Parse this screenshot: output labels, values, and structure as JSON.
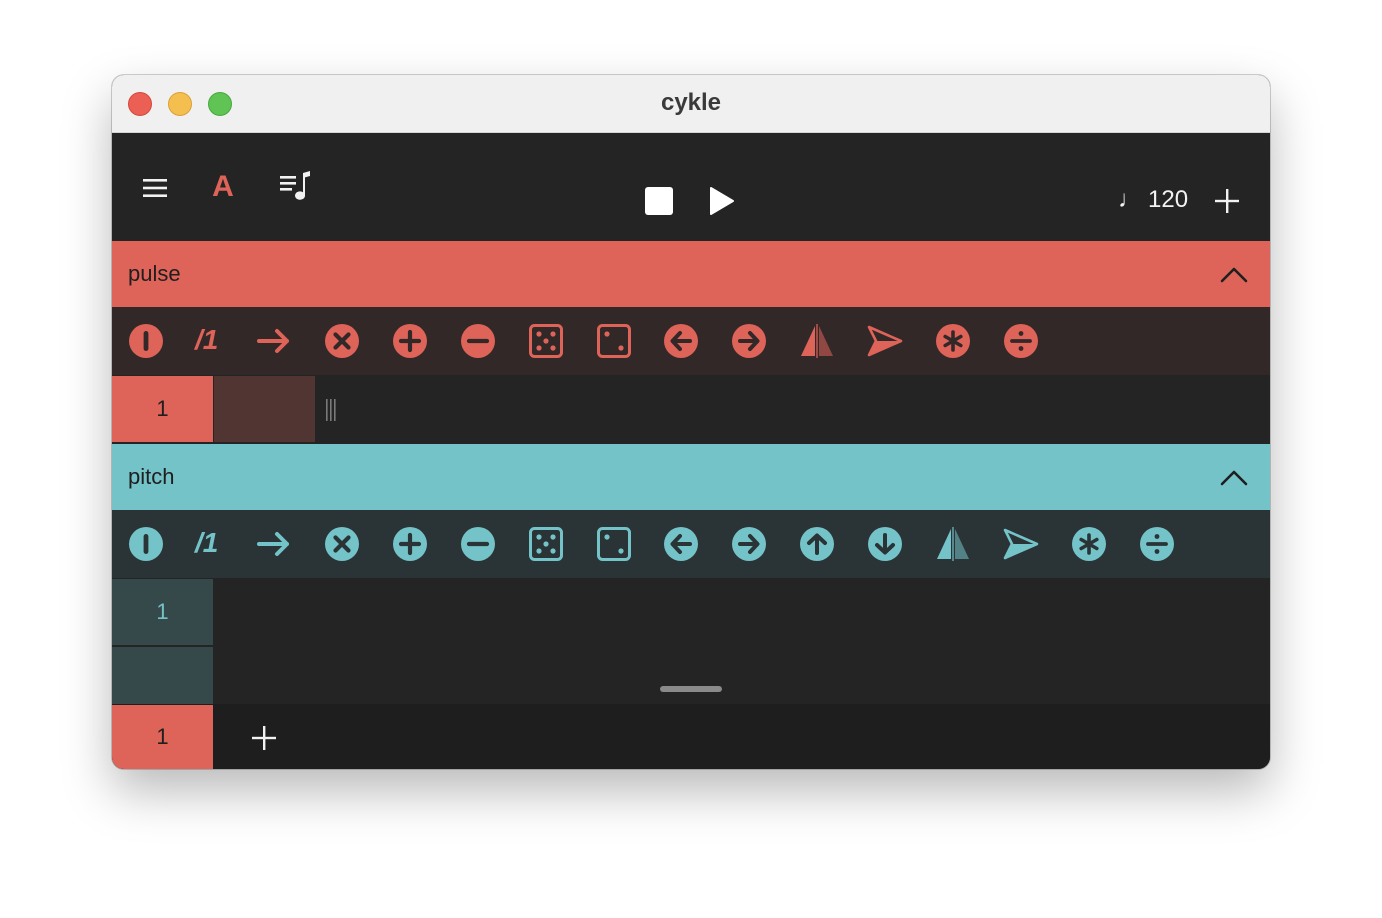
{
  "window": {
    "title": "cykle"
  },
  "toolbar": {
    "menu_icon": "hamburger-icon",
    "preset_letter": "A",
    "notes_icon": "music-list-icon",
    "stop_icon": "stop-icon",
    "play_icon": "play-icon",
    "tempo_note": "♩",
    "tempo_value": "120",
    "add_icon": "plus-icon"
  },
  "colors": {
    "pulse": "#de6359",
    "pulse_row_bg": "#332828",
    "pulse_cell_dim": "#513533",
    "pitch": "#74c3c8",
    "pitch_row_bg": "#2a3335",
    "pitch_cell_bg": "#35494b",
    "dark": "#242424",
    "darker": "#1e1e1e"
  },
  "pulse": {
    "label": "pulse",
    "divider": "/1",
    "step_value": "1",
    "tools": [
      "toggle-icon",
      "arrow-right-icon",
      "close-circle-icon",
      "plus-circle-icon",
      "minus-circle-icon",
      "dice-five-icon",
      "dice-two-icon",
      "arrow-left-circle-icon",
      "arrow-right-circle-icon",
      "mirror-icon",
      "paper-plane-icon",
      "asterisk-circle-icon",
      "divide-circle-icon"
    ]
  },
  "pitch": {
    "label": "pitch",
    "divider": "/1",
    "step_value": "1",
    "tools": [
      "toggle-icon",
      "arrow-right-icon",
      "close-circle-icon",
      "plus-circle-icon",
      "minus-circle-icon",
      "dice-five-icon",
      "dice-two-icon",
      "arrow-left-circle-icon",
      "arrow-right-circle-icon",
      "arrow-up-circle-icon",
      "arrow-down-circle-icon",
      "mirror-icon",
      "paper-plane-icon",
      "asterisk-circle-icon",
      "divide-circle-icon"
    ]
  },
  "footer": {
    "pattern_label": "1",
    "add_icon": "plus-icon"
  }
}
